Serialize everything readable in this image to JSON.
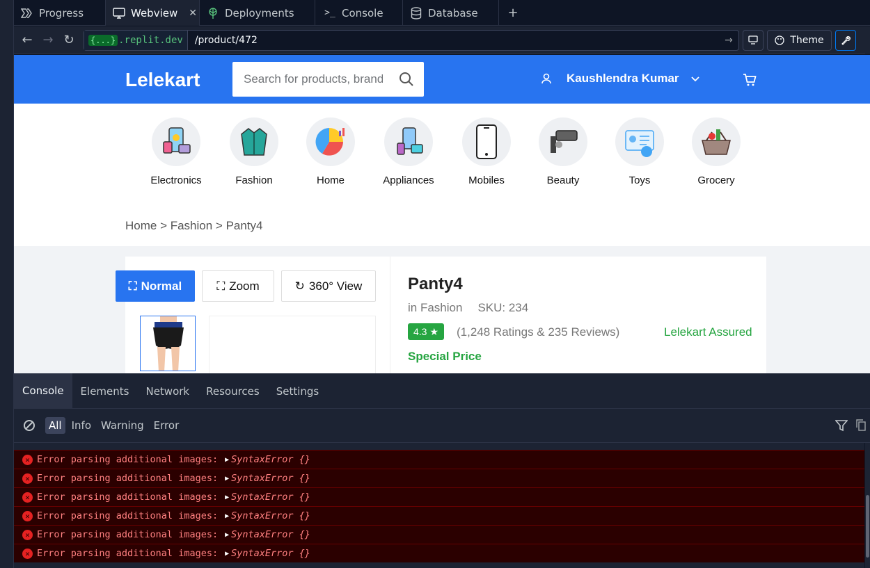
{
  "tabs": [
    {
      "label": "Progress",
      "icon": "progress-icon"
    },
    {
      "label": "Webview",
      "icon": "monitor-icon",
      "active": true
    },
    {
      "label": "Deployments",
      "icon": "deployments-icon"
    },
    {
      "label": "Console",
      "icon": "terminal-icon"
    },
    {
      "label": "Database",
      "icon": "database-icon"
    }
  ],
  "address": {
    "brace": "{...}",
    "host": ".replit.dev",
    "path": "/product/472",
    "theme_label": "Theme"
  },
  "site": {
    "logo": "Lelekart",
    "search_placeholder": "Search for products, brands and more",
    "user_name": "Kaushlendra Kumar"
  },
  "categories": [
    "Electronics",
    "Fashion",
    "Home",
    "Appliances",
    "Mobiles",
    "Beauty",
    "Toys",
    "Grocery"
  ],
  "breadcrumb": "Home > Fashion > Panty4",
  "product": {
    "view_normal": "Normal",
    "view_zoom": "Zoom",
    "view_360": "360° View",
    "name": "Panty4",
    "category": "in Fashion",
    "sku": "SKU: 234",
    "rating": "4.3",
    "rating_counts": "(1,248 Ratings & 235 Reviews)",
    "assured": "Lelekart Assured",
    "special": "Special Price"
  },
  "devtools": {
    "tabs": [
      "Console",
      "Elements",
      "Network",
      "Resources",
      "Settings"
    ],
    "filters": [
      "All",
      "Info",
      "Warning",
      "Error"
    ],
    "errors": [
      {
        "text": "Error parsing additional images:",
        "obj": "SyntaxError {}"
      },
      {
        "text": "Error parsing additional images:",
        "obj": "SyntaxError {}"
      },
      {
        "text": "Error parsing additional images:",
        "obj": "SyntaxError {}"
      },
      {
        "text": "Error parsing additional images:",
        "obj": "SyntaxError {}"
      },
      {
        "text": "Error parsing additional images:",
        "obj": "SyntaxError {}"
      },
      {
        "text": "Error parsing additional images:",
        "obj": "SyntaxError {}"
      }
    ]
  }
}
